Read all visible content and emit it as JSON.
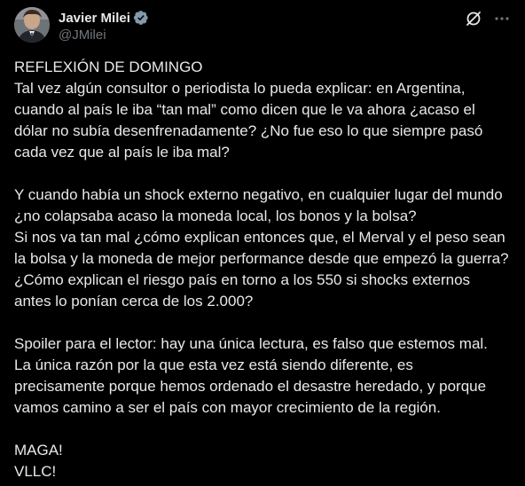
{
  "colors": {
    "background": "#000000",
    "text_primary": "#e7e9ea",
    "text_secondary": "#71767b",
    "verified_badge": "#829aab"
  },
  "author": {
    "display_name": "Javier Milei",
    "handle": "@JMilei",
    "avatar_icon": "avatar",
    "verified_icon": "verified-badge-icon"
  },
  "actions": {
    "grok_icon": "grok-icon",
    "more_icon": "more-options-icon"
  },
  "post": {
    "paragraph_1": [
      "REFLEXIÓN DE DOMINGO",
      "Tal vez algún consultor o periodista lo pueda explicar: en Argentina,",
      "cuando al país le iba “tan mal” como dicen que le va ahora ¿acaso el",
      "dólar no subía desenfrenadamente? ¿No fue eso lo que siempre pasó",
      "cada vez que al país le iba mal?"
    ],
    "paragraph_2": [
      "Y cuando había un shock externo negativo, en cualquier lugar del mundo",
      "¿no colapsaba acaso la moneda local, los bonos y la bolsa?",
      "Si nos va tan mal ¿cómo explican entonces que, el Merval y el peso sean",
      "la bolsa y la moneda de mejor performance desde que empezó la guerra?",
      "¿Cómo explican el riesgo país en torno a los 550 si shocks externos",
      "antes lo ponían cerca de los 2.000?"
    ],
    "paragraph_3": [
      "Spoiler para el lector: hay una única lectura, es falso que estemos mal.",
      "La única razón por la que esta vez está siendo diferente, es",
      "precisamente porque hemos ordenado el desastre heredado, y porque",
      "vamos camino a ser el país con mayor crecimiento de la región."
    ],
    "paragraph_4": [
      "MAGA!",
      "VLLC!"
    ]
  }
}
